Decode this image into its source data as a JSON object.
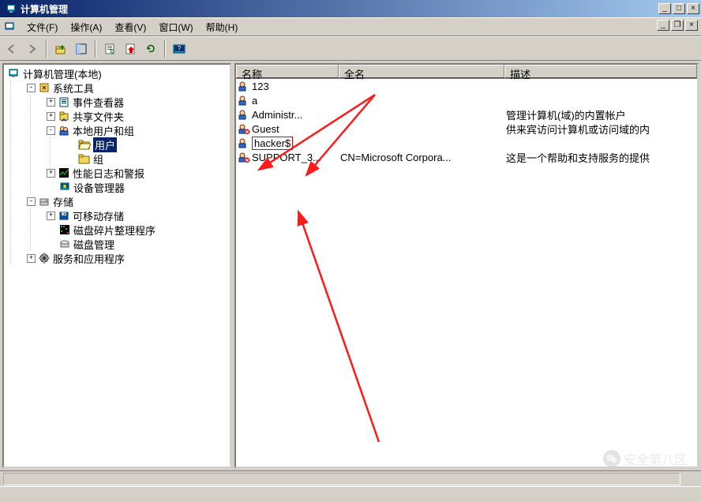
{
  "window": {
    "title": "计算机管理"
  },
  "menu": {
    "file": "文件(F)",
    "action": "操作(A)",
    "view": "查看(V)",
    "window": "窗口(W)",
    "help": "帮助(H)"
  },
  "tree": {
    "root": "计算机管理(本地)",
    "system_tools": "系统工具",
    "event_viewer": "事件查看器",
    "shared_folders": "共享文件夹",
    "local_users_groups": "本地用户和组",
    "users": "用户",
    "groups": "组",
    "perf_logs": "性能日志和警报",
    "device_mgr": "设备管理器",
    "storage": "存储",
    "removable": "可移动存储",
    "defrag": "磁盘碎片整理程序",
    "disk_mgmt": "磁盘管理",
    "services_apps": "服务和应用程序"
  },
  "list": {
    "columns": {
      "name": "名称",
      "fullname": "全名",
      "desc": "描述"
    },
    "rows": [
      {
        "name": "123",
        "fullname": "",
        "desc": "",
        "disabled": false
      },
      {
        "name": "a",
        "fullname": "",
        "desc": "",
        "disabled": false
      },
      {
        "name": "Administr...",
        "fullname": "",
        "desc": "管理计算机(域)的内置帐户",
        "disabled": false
      },
      {
        "name": "Guest",
        "fullname": "",
        "desc": "供来宾访问计算机或访问域的内",
        "disabled": true
      },
      {
        "name": "hacker$",
        "fullname": "",
        "desc": "",
        "disabled": false,
        "highlight": true
      },
      {
        "name": "SUPPORT_3...",
        "fullname": "CN=Microsoft Corpora...",
        "desc": "这是一个帮助和支持服务的提供",
        "disabled": true
      }
    ]
  },
  "watermark": "安全第八区"
}
